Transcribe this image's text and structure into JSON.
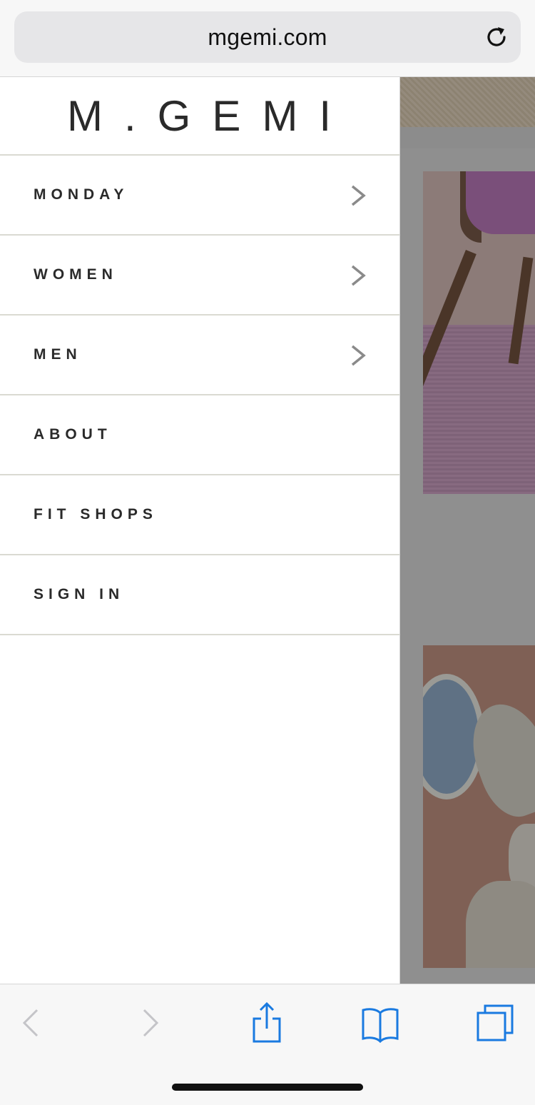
{
  "browser": {
    "url": "mgemi.com",
    "icons": {
      "reload": "reload-icon",
      "back": "chevron-left-icon",
      "forward": "chevron-right-icon",
      "share": "share-icon",
      "bookmarks": "book-icon",
      "tabs": "tabs-icon"
    },
    "accent": "#1a7ae0"
  },
  "drawer": {
    "logo": "M.GEMI",
    "items": [
      {
        "label": "MONDAY",
        "has_submenu": true
      },
      {
        "label": "WOMEN",
        "has_submenu": true
      },
      {
        "label": "MEN",
        "has_submenu": true
      },
      {
        "label": "ABOUT",
        "has_submenu": false
      },
      {
        "label": "FIT SHOPS",
        "has_submenu": false
      },
      {
        "label": "SIGN IN",
        "has_submenu": false
      }
    ]
  }
}
